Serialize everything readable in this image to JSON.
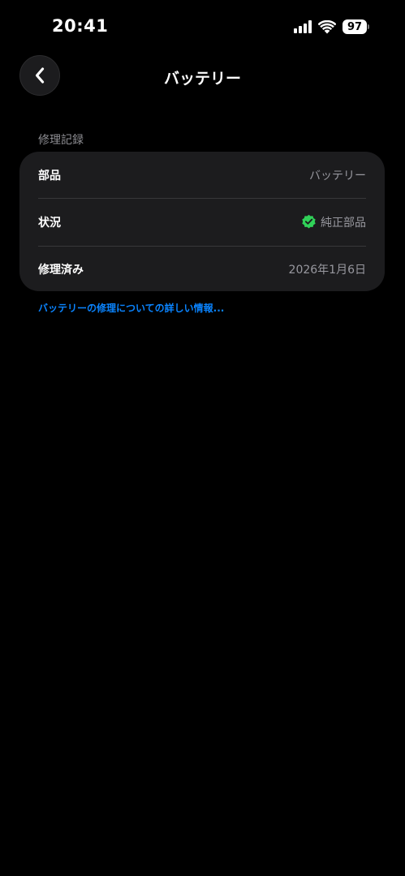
{
  "status_bar": {
    "time": "20:41",
    "battery_level": "97",
    "signal_bars": 4,
    "wifi": true
  },
  "nav": {
    "title": "バッテリー",
    "back_icon": "chevron-left-icon"
  },
  "repair_section": {
    "header": "修理記録",
    "rows": [
      {
        "label": "部品",
        "value": "バッテリー"
      },
      {
        "label": "状況",
        "value": "純正部品",
        "icon": "verified-badge-icon"
      },
      {
        "label": "修理済み",
        "value": "2026年1月6日"
      }
    ],
    "link": "バッテリーの修理についての詳しい情報..."
  },
  "colors": {
    "background": "#000000",
    "card": "#1c1c1e",
    "secondary_text": "#98989f",
    "link": "#0a84ff",
    "verified_green": "#30d158"
  }
}
